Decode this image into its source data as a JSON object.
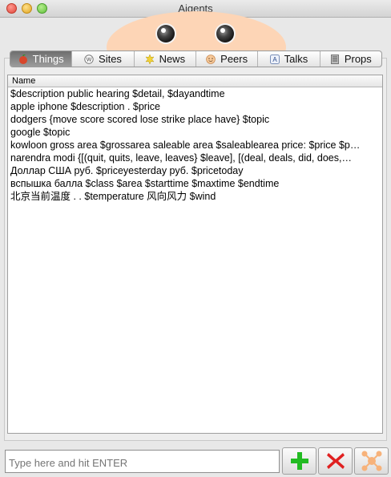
{
  "window": {
    "title": "Aigents"
  },
  "tabs": [
    {
      "label": "Things",
      "icon": "apple-icon",
      "active": true
    },
    {
      "label": "Sites",
      "icon": "globe-icon",
      "active": false
    },
    {
      "label": "News",
      "icon": "news-icon",
      "active": false
    },
    {
      "label": "Peers",
      "icon": "smiley-icon",
      "active": false
    },
    {
      "label": "Talks",
      "icon": "text-icon",
      "active": false
    },
    {
      "label": "Props",
      "icon": "props-icon",
      "active": false
    }
  ],
  "list": {
    "header": "Name",
    "rows": [
      "$description public hearing $detail, $dayandtime",
      "apple iphone $description . $price",
      "dodgers {move score scored lose strike place have} $topic",
      "google $topic",
      "kowloon gross area $grossarea saleable area $saleablearea price: $price $p…",
      "narendra modi {[(quit, quits, leave, leaves} $leave], [(deal, deals, did, does,…",
      "Доллар США руб. $priceyesterday руб. $pricetoday",
      "вспышка балла $class $area $starttime $maxtime $endtime",
      "北京当前温度 . . $temperature 风向风力 $wind"
    ]
  },
  "input": {
    "placeholder": "Type here and hit ENTER"
  },
  "colors": {
    "add": "#22bb22",
    "delete": "#e02020",
    "peer": "#f7b27a",
    "face": "#fdd5b6"
  }
}
